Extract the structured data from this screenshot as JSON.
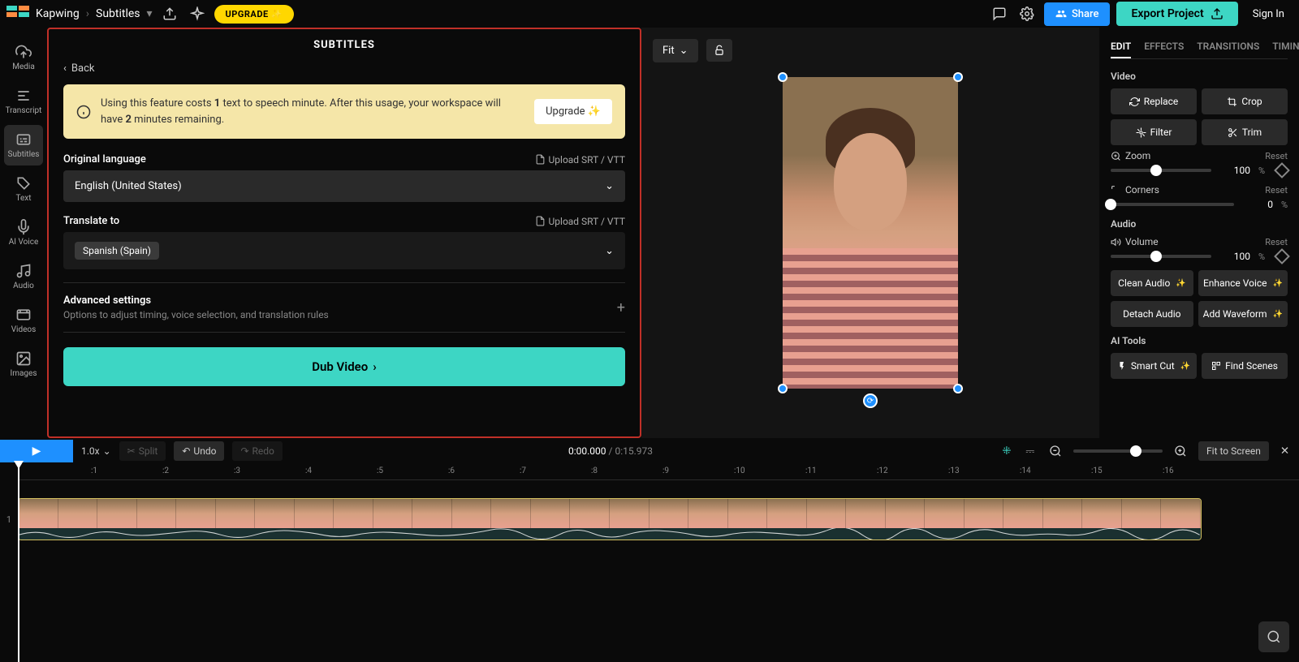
{
  "header": {
    "app": "Kapwing",
    "page": "Subtitles",
    "upgrade": "UPGRADE",
    "share": "Share",
    "export": "Export Project",
    "signin": "Sign In"
  },
  "rail": {
    "media": "Media",
    "transcript": "Transcript",
    "subtitles": "Subtitles",
    "text": "Text",
    "aivoice": "AI Voice",
    "audio": "Audio",
    "videos": "Videos",
    "images": "Images"
  },
  "panel": {
    "title": "SUBTITLES",
    "back": "Back",
    "notice_pre": "Using this feature costs ",
    "notice_bold1": "1",
    "notice_mid": " text to speech minute. After this usage, your workspace will have ",
    "notice_bold2": "2",
    "notice_post": " minutes remaining.",
    "notice_upgrade": "Upgrade",
    "orig_label": "Original language",
    "upload_srt": "Upload SRT / VTT",
    "orig_value": "English (United States)",
    "trans_label": "Translate to",
    "trans_value": "Spanish (Spain)",
    "adv_title": "Advanced settings",
    "adv_sub": "Options to adjust timing, voice selection, and translation rules",
    "dub": "Dub Video"
  },
  "canvas": {
    "fit": "Fit"
  },
  "right": {
    "tabs": {
      "edit": "EDIT",
      "effects": "EFFECTS",
      "transitions": "TRANSITIONS",
      "timing": "TIMING"
    },
    "video": "Video",
    "replace": "Replace",
    "crop": "Crop",
    "filter": "Filter",
    "trim": "Trim",
    "zoom": "Zoom",
    "reset": "Reset",
    "zoom_val": "100",
    "corners": "Corners",
    "corners_val": "0",
    "audio": "Audio",
    "volume": "Volume",
    "volume_val": "100",
    "clean": "Clean Audio",
    "enhance": "Enhance Voice",
    "detach": "Detach Audio",
    "addwave": "Add Waveform",
    "aitools": "AI Tools",
    "smartcut": "Smart Cut",
    "findscenes": "Find Scenes"
  },
  "transport": {
    "speed": "1.0x",
    "split": "Split",
    "undo": "Undo",
    "redo": "Redo",
    "current": "0:00.000",
    "total": "0:15.973",
    "fit": "Fit to Screen"
  },
  "ruler": [
    ":1",
    ":2",
    ":3",
    ":4",
    ":5",
    ":6",
    ":7",
    ":8",
    ":9",
    ":10",
    ":11",
    ":12",
    ":13",
    ":14",
    ":15",
    ":16"
  ],
  "track_num": "1"
}
